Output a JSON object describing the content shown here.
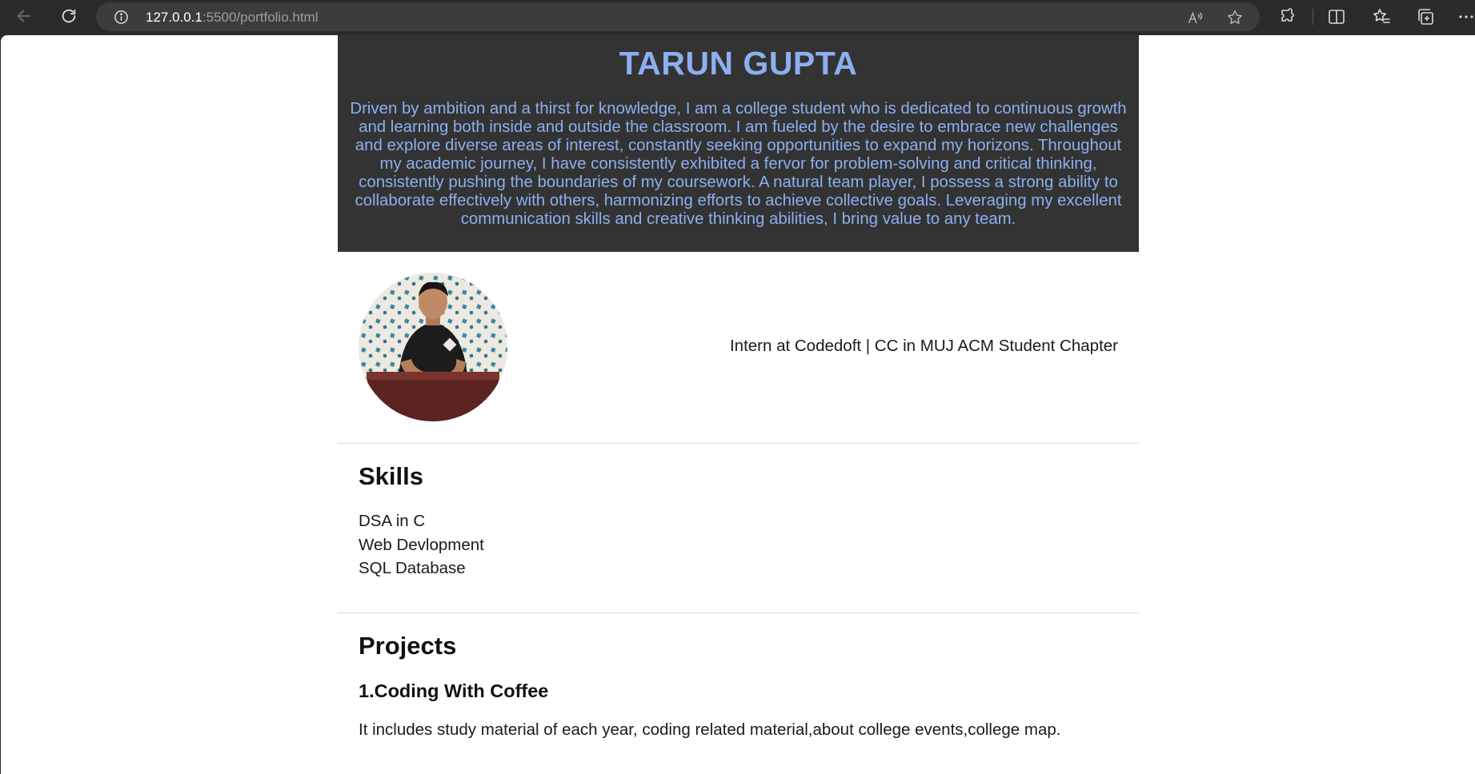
{
  "browser": {
    "url_host": "127.0.0.1",
    "url_path": ":5500/portfolio.html"
  },
  "hero": {
    "name": "TARUN GUPTA",
    "bio": "Driven by ambition and a thirst for knowledge, I am a college student who is dedicated to continuous growth and learning both inside and outside the classroom. I am fueled by the desire to embrace new challenges and explore diverse areas of interest, constantly seeking opportunities to expand my horizons. Throughout my academic journey, I have consistently exhibited a fervor for problem-solving and critical thinking, consistently pushing the boundaries of my coursework. A natural team player, I possess a strong ability to collaborate effectively with others, harmonizing efforts to achieve collective goals. Leveraging my excellent communication skills and creative thinking abilities, I bring value to any team."
  },
  "profile": {
    "role": "Intern at Codedoft | CC in MUJ ACM Student Chapter"
  },
  "skills": {
    "heading": "Skills",
    "items": [
      "DSA in C",
      "Web Devlopment",
      "SQL Database"
    ]
  },
  "projects": {
    "heading": "Projects",
    "items": [
      {
        "title": "1.Coding With Coffee",
        "description": "It includes study material of each year, coding related material,about college events,college map."
      }
    ]
  },
  "colors": {
    "hero_bg": "#333333",
    "hero_text": "#8caff0",
    "browser_chrome": "#2b2b2b"
  }
}
